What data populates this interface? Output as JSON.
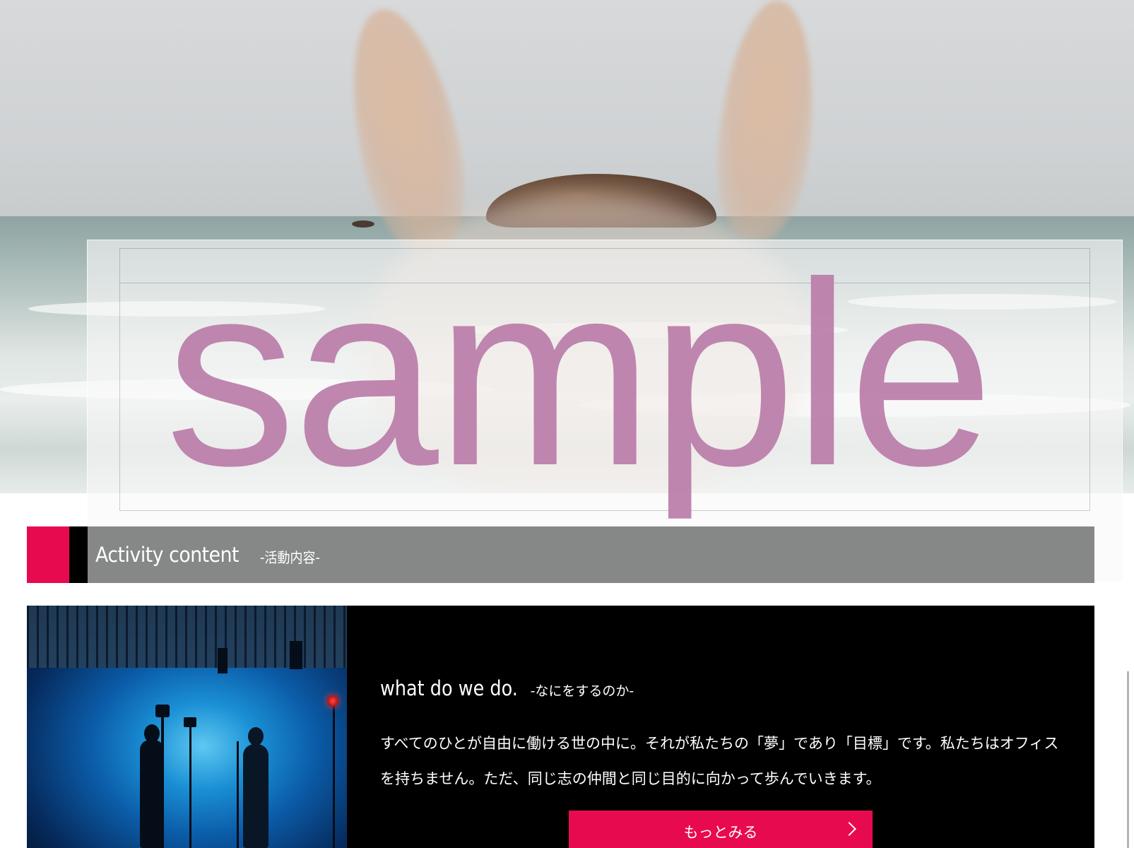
{
  "hero": {
    "image_label": "beach-with-rabbit-ears-photo"
  },
  "section": {
    "title": "Activity content",
    "subtitle": "-活動内容-",
    "accent_color": "#e80a4e",
    "bar_color": "#868787"
  },
  "card": {
    "heading": "what do we do.",
    "heading_sub": "-なにをするのか-",
    "body": "すべてのひとが自由に働ける世の中に。それが私たちの「夢」であり「目標」です。私たちはオフィスを持ちません。ただ、同じ志の仲間と同じ目的に向かって歩んでいきます。",
    "button_label": "もっとみる",
    "button_icon": "chevron-right-icon",
    "image_label": "studio-photoshoot-photo"
  },
  "watermark": {
    "text": "sample",
    "color": "#bd7fab"
  }
}
